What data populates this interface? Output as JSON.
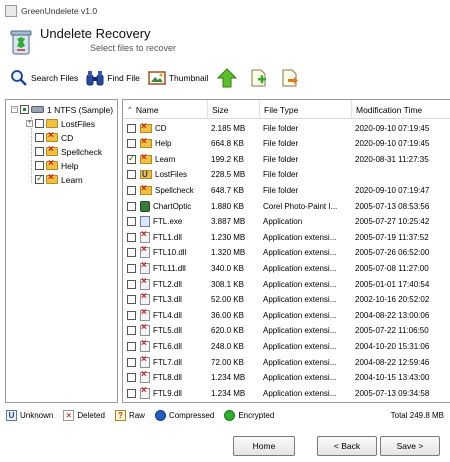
{
  "window": {
    "title": "GreenUndelete v1.0"
  },
  "header": {
    "title": "Undelete Recovery",
    "subtitle": "Select files to recover"
  },
  "toolbar": {
    "search_label": "Search Files",
    "find_label": "Find File",
    "thumbnail_label": "Thumbnail"
  },
  "tree": {
    "root_label": "1 NTFS (Sample)",
    "items": [
      {
        "label": "LostFiles",
        "checked": false
      },
      {
        "label": "CD",
        "checked": false
      },
      {
        "label": "Spellcheck",
        "checked": false
      },
      {
        "label": "Help",
        "checked": false
      },
      {
        "label": "Learn",
        "checked": true
      }
    ]
  },
  "list": {
    "columns": [
      "Name",
      "Size",
      "File Type",
      "Modification Time"
    ],
    "rows": [
      {
        "name": "CD",
        "size": "2.185 MB",
        "type": "File folder",
        "modified": "2020-09-10 07:19:45",
        "checked": false,
        "icon": "deleted-folder"
      },
      {
        "name": "Help",
        "size": "664.8 KB",
        "type": "File folder",
        "modified": "2020-09-10 07:19:45",
        "checked": false,
        "icon": "deleted-folder"
      },
      {
        "name": "Learn",
        "size": "199.2 KB",
        "type": "File folder",
        "modified": "2020-08-31 11:27:35",
        "checked": true,
        "icon": "deleted-folder"
      },
      {
        "name": "LostFiles",
        "size": "228.5 MB",
        "type": "File folder",
        "modified": "",
        "checked": false,
        "icon": "unknown-folder"
      },
      {
        "name": "Spellcheck",
        "size": "648.7 KB",
        "type": "File folder",
        "modified": "2020-09-10 07:19:47",
        "checked": false,
        "icon": "deleted-folder"
      },
      {
        "name": "ChartOptic",
        "size": "1.880 KB",
        "type": "Corel Photo-Paint I...",
        "modified": "2005-07-13 08:53:56",
        "checked": false,
        "icon": "corel-file"
      },
      {
        "name": "FTL.exe",
        "size": "3.887 MB",
        "type": "Application",
        "modified": "2005-07-27 10:25:42",
        "checked": false,
        "icon": "exe-file"
      },
      {
        "name": "FTL1.dll",
        "size": "1.230 MB",
        "type": "Application extensi...",
        "modified": "2005-07-19 11:37:52",
        "checked": false,
        "icon": "deleted-dll"
      },
      {
        "name": "FTL10.dll",
        "size": "1.320 MB",
        "type": "Application extensi...",
        "modified": "2005-07-26 06:52:00",
        "checked": false,
        "icon": "deleted-dll"
      },
      {
        "name": "FTL11.dll",
        "size": "340.0 KB",
        "type": "Application extensi...",
        "modified": "2005-07-08 11:27:00",
        "checked": false,
        "icon": "deleted-dll"
      },
      {
        "name": "FTL2.dll",
        "size": "308.1 KB",
        "type": "Application extensi...",
        "modified": "2005-01-01 17:40:54",
        "checked": false,
        "icon": "deleted-dll"
      },
      {
        "name": "FTL3.dll",
        "size": "52.00 KB",
        "type": "Application extensi...",
        "modified": "2002-10-16 20:52:02",
        "checked": false,
        "icon": "deleted-dll"
      },
      {
        "name": "FTL4.dll",
        "size": "36.00 KB",
        "type": "Application extensi...",
        "modified": "2004-08-22 13:00:06",
        "checked": false,
        "icon": "deleted-dll"
      },
      {
        "name": "FTL5.dll",
        "size": "620.0 KB",
        "type": "Application extensi...",
        "modified": "2005-07-22 11:06:50",
        "checked": false,
        "icon": "deleted-dll"
      },
      {
        "name": "FTL6.dll",
        "size": "248.0 KB",
        "type": "Application extensi...",
        "modified": "2004-10-20 15:31:06",
        "checked": false,
        "icon": "deleted-dll"
      },
      {
        "name": "FTL7.dll",
        "size": "72.00 KB",
        "type": "Application extensi...",
        "modified": "2004-08-22 12:59:46",
        "checked": false,
        "icon": "deleted-dll"
      },
      {
        "name": "FTL8.dll",
        "size": "1.234 MB",
        "type": "Application extensi...",
        "modified": "2004-10-15 13:43:00",
        "checked": false,
        "icon": "deleted-dll"
      },
      {
        "name": "FTL9.dll",
        "size": "1.234 MB",
        "type": "Application extensi...",
        "modified": "2005-07-13 09:34:58",
        "checked": false,
        "icon": "deleted-dll"
      }
    ]
  },
  "legend": {
    "unknown": "Unknown",
    "deleted": "Deleted",
    "raw": "Raw",
    "compressed": "Compressed",
    "encrypted": "Encrypted"
  },
  "status": {
    "total": "Total 249.8 MB"
  },
  "buttons": {
    "home": "Home",
    "back": "< Back",
    "save": "Save >"
  },
  "colors": {
    "accent_green": "#2fae2f",
    "deleted_red": "#d21b1b",
    "compressed_blue": "#1f5fbf",
    "folder_yellow": "#f0c040"
  }
}
